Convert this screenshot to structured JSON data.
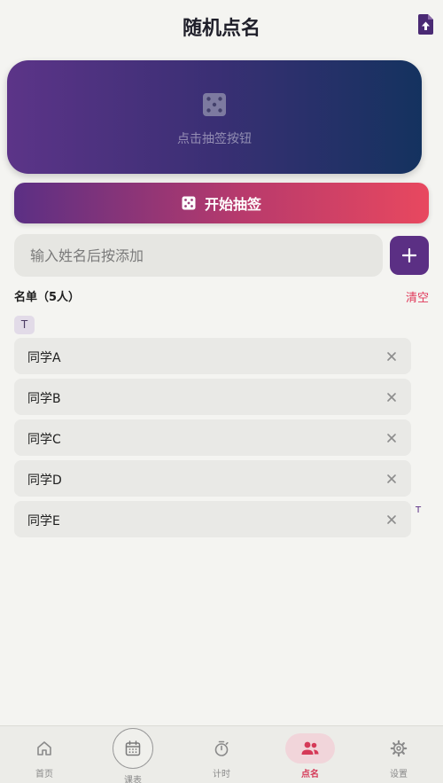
{
  "header": {
    "title": "随机点名"
  },
  "result": {
    "hint": "点击抽签按钮"
  },
  "start_button": {
    "label": "开始抽签"
  },
  "input": {
    "placeholder": "输入姓名后按添加",
    "value": ""
  },
  "list": {
    "title": "名单（5人）",
    "clear_label": "清空",
    "group_letter": "T",
    "items": [
      {
        "name": "同学A"
      },
      {
        "name": "同学B"
      },
      {
        "name": "同学C"
      },
      {
        "name": "同学D"
      },
      {
        "name": "同学E"
      }
    ],
    "index_letters": [
      "T"
    ]
  },
  "nav": {
    "items": [
      {
        "label": "首页",
        "icon": "home-icon"
      },
      {
        "label": "课表",
        "icon": "calendar-icon"
      },
      {
        "label": "计时",
        "icon": "stopwatch-icon"
      },
      {
        "label": "点名",
        "icon": "people-icon",
        "active": true
      },
      {
        "label": "设置",
        "icon": "gear-icon"
      }
    ]
  },
  "colors": {
    "primary": "#5b2f84",
    "accent": "#e8485f",
    "active_nav": "#d53a58"
  }
}
